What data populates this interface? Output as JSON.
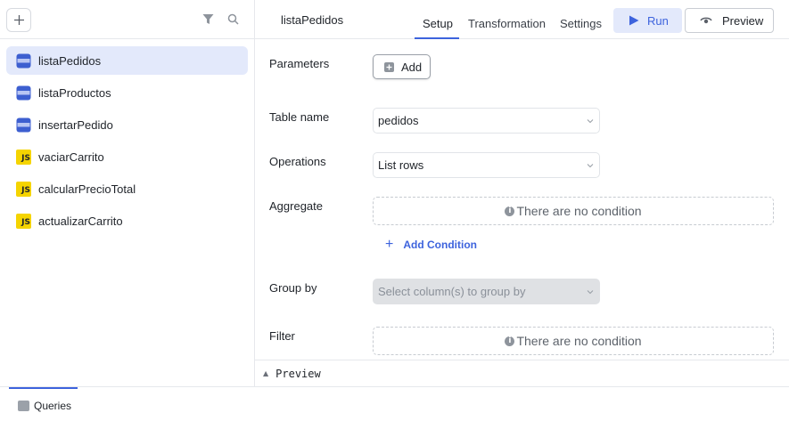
{
  "sidebar": {
    "add_icon": "plus-icon",
    "filter_icon": "filter-icon",
    "search_icon": "search-icon",
    "queries": [
      {
        "label": "listaPedidos",
        "type": "table",
        "active": true
      },
      {
        "label": "listaProductos",
        "type": "table",
        "active": false
      },
      {
        "label": "insertarPedido",
        "type": "table",
        "active": false
      },
      {
        "label": "vaciarCarrito",
        "type": "js",
        "active": false
      },
      {
        "label": "calcularPrecioTotal",
        "type": "js",
        "active": false
      },
      {
        "label": "actualizarCarrito",
        "type": "js",
        "active": false
      }
    ],
    "js_badge": "JS"
  },
  "header": {
    "query_name": "listaPedidos",
    "tabs": [
      {
        "label": "Setup",
        "active": true
      },
      {
        "label": "Transformation",
        "active": false
      },
      {
        "label": "Settings",
        "active": false
      }
    ],
    "run_label": "Run",
    "preview_label": "Preview"
  },
  "form": {
    "parameters_label": "Parameters",
    "add_label": "Add",
    "table_name_label": "Table name",
    "table_name_value": "pedidos",
    "operations_label": "Operations",
    "operations_value": "List rows",
    "aggregate_label": "Aggregate",
    "aggregate_empty": "There are no condition",
    "add_condition_label": "Add Condition",
    "group_by_label": "Group by",
    "group_by_placeholder": "Select column(s) to group by",
    "filter_label": "Filter",
    "filter_empty": "There are no condition",
    "info_glyph": "i"
  },
  "preview_panel": {
    "label": "Preview"
  },
  "footer": {
    "queries_tab": "Queries"
  },
  "colors": {
    "accent": "#3d63dd",
    "active_bg": "#e3e9fb",
    "js_yellow": "#f5d400"
  }
}
